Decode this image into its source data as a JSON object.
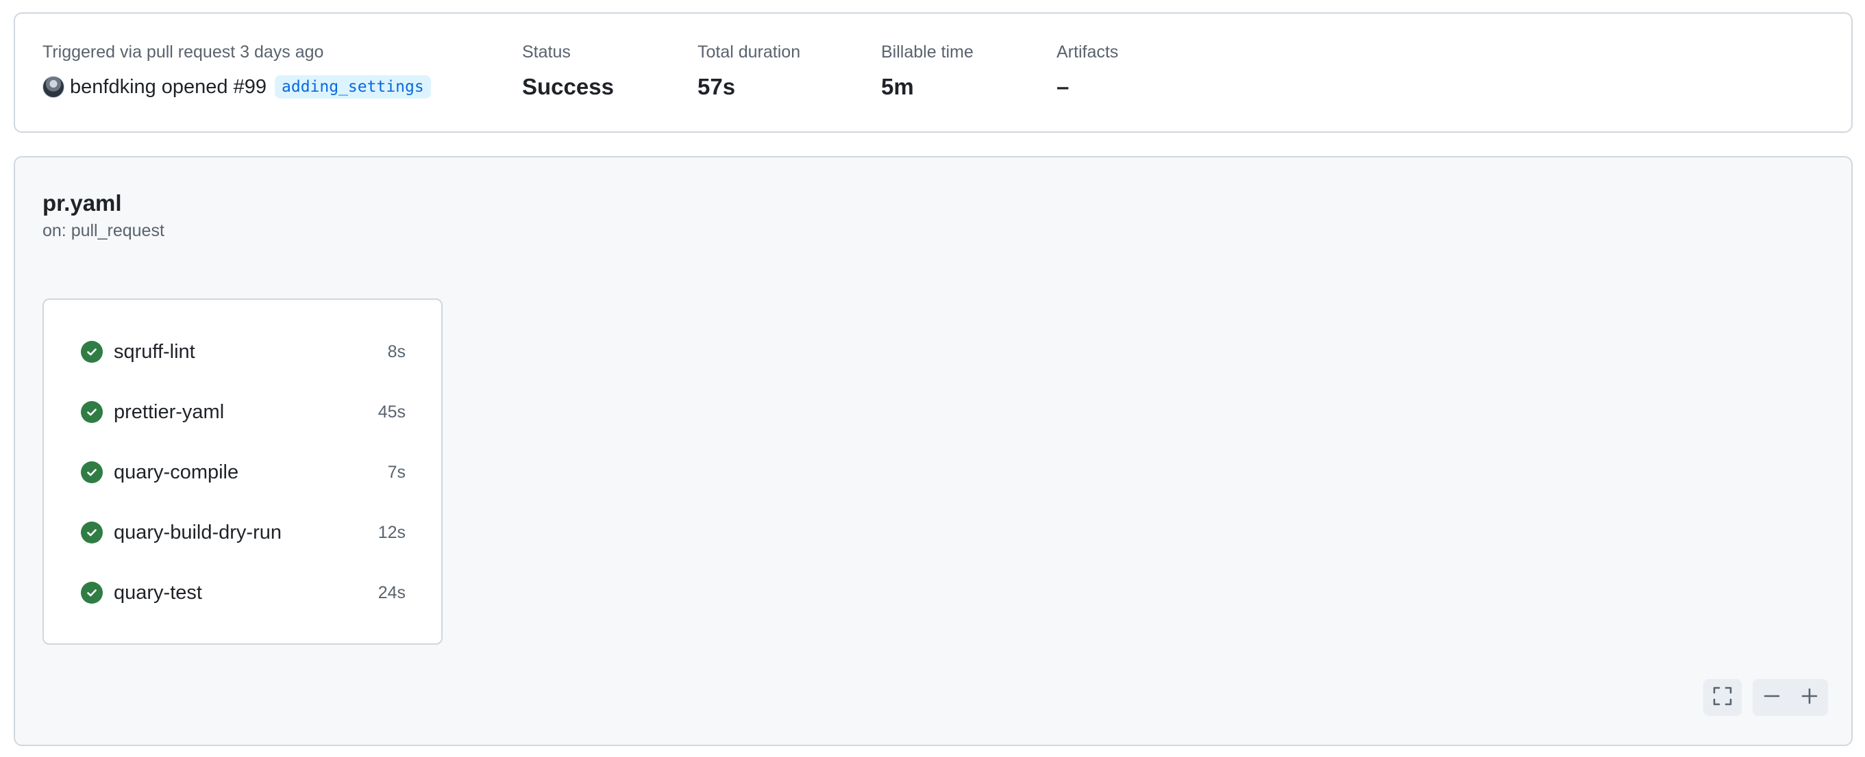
{
  "summary": {
    "trigger_label": "Triggered via pull request 3 days ago",
    "user": "benfdking",
    "action": "opened #99",
    "branch": "adding_settings",
    "status_label": "Status",
    "status_value": "Success",
    "duration_label": "Total duration",
    "duration_value": "57s",
    "billable_label": "Billable time",
    "billable_value": "5m",
    "artifacts_label": "Artifacts",
    "artifacts_value": "–"
  },
  "workflow": {
    "name": "pr.yaml",
    "trigger": "on: pull_request"
  },
  "jobs": [
    {
      "name": "sqruff-lint",
      "duration": "8s",
      "status": "success"
    },
    {
      "name": "prettier-yaml",
      "duration": "45s",
      "status": "success"
    },
    {
      "name": "quary-compile",
      "duration": "7s",
      "status": "success"
    },
    {
      "name": "quary-build-dry-run",
      "duration": "12s",
      "status": "success"
    },
    {
      "name": "quary-test",
      "duration": "24s",
      "status": "success"
    }
  ],
  "colors": {
    "success": "#2f7d44",
    "branch_text": "#0969da",
    "branch_bg": "#ddf4ff"
  },
  "icons": {
    "job_status": "check-circle-icon",
    "fullscreen": "fullscreen-icon",
    "zoom_out": "minus-icon",
    "zoom_in": "plus-icon"
  }
}
